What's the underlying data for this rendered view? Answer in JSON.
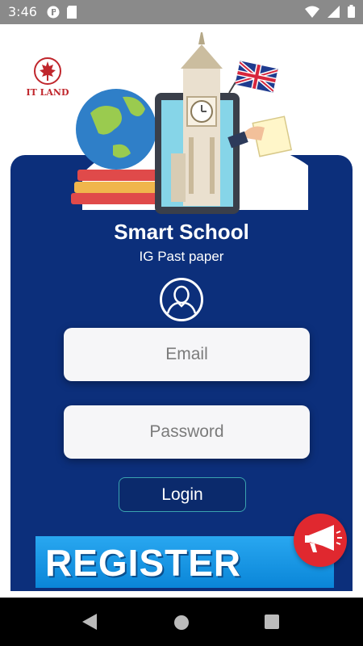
{
  "status_bar": {
    "time": "3:46",
    "left_icons": [
      "pocket-app-icon",
      "sd-card-icon"
    ],
    "right_icons": [
      "wifi-icon",
      "signal-icon",
      "battery-icon"
    ]
  },
  "logo": {
    "text": "IT LAND",
    "icon": "maple-leaf-icon"
  },
  "hero": {
    "icon": "education-illustration"
  },
  "app": {
    "title": "Smart School",
    "subtitle": "IG Past paper"
  },
  "avatar": {
    "icon": "user-avatar-icon"
  },
  "form": {
    "email_placeholder": "Email",
    "email_value": "",
    "password_placeholder": "Password",
    "password_value": "",
    "login_label": "Login"
  },
  "register": {
    "label": "REGISTER NOW",
    "icon": "megaphone-icon"
  },
  "nav": {
    "icons": [
      "back-icon",
      "home-icon",
      "recents-icon"
    ]
  },
  "colors": {
    "card": "#0c2f7b",
    "field": "#f6f6f8",
    "banner": "#1a9be8",
    "megaphone": "#e0282f"
  }
}
